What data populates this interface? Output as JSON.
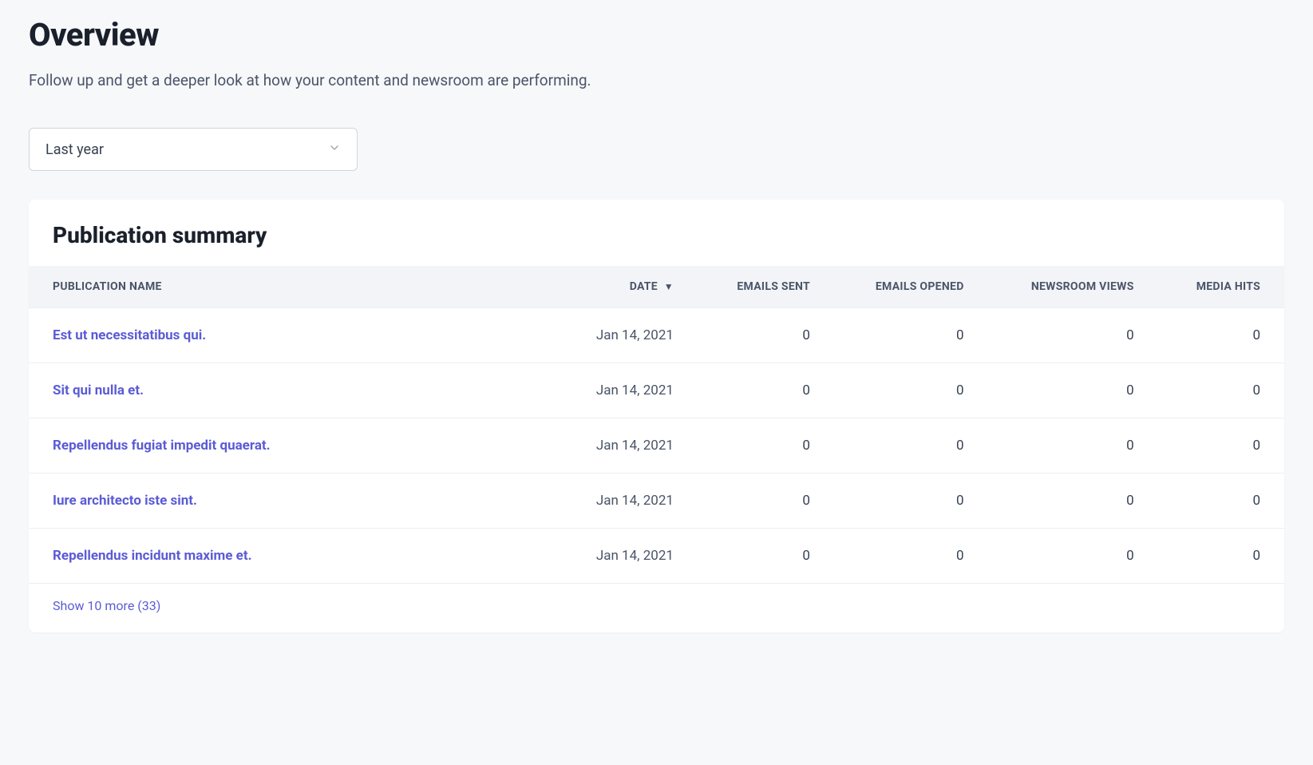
{
  "header": {
    "title": "Overview",
    "subtitle": "Follow up and get a deeper look at how your content and newsroom are performing."
  },
  "filter": {
    "selected": "Last year"
  },
  "summary": {
    "title": "Publication summary",
    "columns": {
      "name": "Publication name",
      "date": "Date",
      "emails_sent": "Emails sent",
      "emails_opened": "Emails opened",
      "newsroom_views": "Newsroom views",
      "media_hits": "Media hits"
    },
    "rows": [
      {
        "name": "Est ut necessitatibus qui.",
        "date": "Jan 14, 2021",
        "emails_sent": "0",
        "emails_opened": "0",
        "newsroom_views": "0",
        "media_hits": "0"
      },
      {
        "name": "Sit qui nulla et.",
        "date": "Jan 14, 2021",
        "emails_sent": "0",
        "emails_opened": "0",
        "newsroom_views": "0",
        "media_hits": "0"
      },
      {
        "name": "Repellendus fugiat impedit quaerat.",
        "date": "Jan 14, 2021",
        "emails_sent": "0",
        "emails_opened": "0",
        "newsroom_views": "0",
        "media_hits": "0"
      },
      {
        "name": "Iure architecto iste sint.",
        "date": "Jan 14, 2021",
        "emails_sent": "0",
        "emails_opened": "0",
        "newsroom_views": "0",
        "media_hits": "0"
      },
      {
        "name": "Repellendus incidunt maxime et.",
        "date": "Jan 14, 2021",
        "emails_sent": "0",
        "emails_opened": "0",
        "newsroom_views": "0",
        "media_hits": "0"
      }
    ],
    "show_more": "Show 10 more (33)"
  }
}
